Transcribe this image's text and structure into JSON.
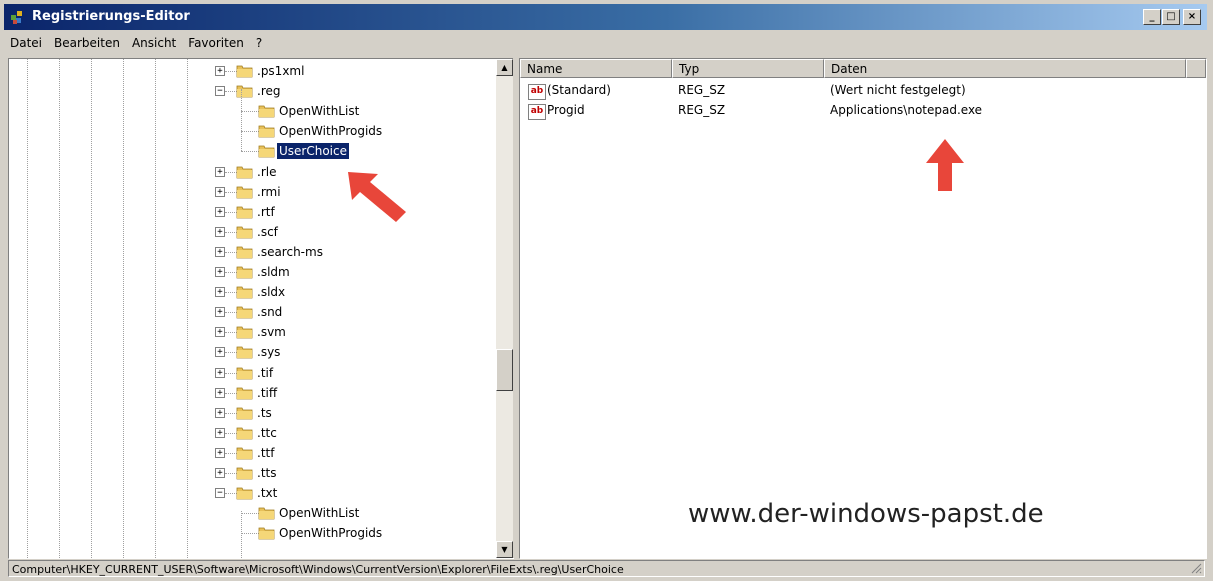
{
  "window": {
    "title": "Registrierungs-Editor"
  },
  "titlebar_buttons": {
    "minimize": "_",
    "maximize": "□",
    "close": "×"
  },
  "menu": [
    "Datei",
    "Bearbeiten",
    "Ansicht",
    "Favoriten",
    "?"
  ],
  "tree": [
    {
      "label": ".ps1xml",
      "expander": "+",
      "depth": 0
    },
    {
      "label": ".reg",
      "expander": "−",
      "depth": 0
    },
    {
      "label": "OpenWithList",
      "expander": "",
      "depth": 1
    },
    {
      "label": "OpenWithProgids",
      "expander": "",
      "depth": 1
    },
    {
      "label": "UserChoice",
      "expander": "",
      "depth": 1,
      "selected": true
    },
    {
      "label": ".rle",
      "expander": "+",
      "depth": 0
    },
    {
      "label": ".rmi",
      "expander": "+",
      "depth": 0
    },
    {
      "label": ".rtf",
      "expander": "+",
      "depth": 0
    },
    {
      "label": ".scf",
      "expander": "+",
      "depth": 0
    },
    {
      "label": ".search-ms",
      "expander": "+",
      "depth": 0
    },
    {
      "label": ".sldm",
      "expander": "+",
      "depth": 0
    },
    {
      "label": ".sldx",
      "expander": "+",
      "depth": 0
    },
    {
      "label": ".snd",
      "expander": "+",
      "depth": 0
    },
    {
      "label": ".svm",
      "expander": "+",
      "depth": 0
    },
    {
      "label": ".sys",
      "expander": "+",
      "depth": 0
    },
    {
      "label": ".tif",
      "expander": "+",
      "depth": 0
    },
    {
      "label": ".tiff",
      "expander": "+",
      "depth": 0
    },
    {
      "label": ".ts",
      "expander": "+",
      "depth": 0
    },
    {
      "label": ".ttc",
      "expander": "+",
      "depth": 0
    },
    {
      "label": ".ttf",
      "expander": "+",
      "depth": 0
    },
    {
      "label": ".tts",
      "expander": "+",
      "depth": 0
    },
    {
      "label": ".txt",
      "expander": "−",
      "depth": 0
    },
    {
      "label": "OpenWithList",
      "expander": "",
      "depth": 1
    },
    {
      "label": "OpenWithProgids",
      "expander": "",
      "depth": 1
    }
  ],
  "values_table": {
    "columns": [
      "Name",
      "Typ",
      "Daten"
    ],
    "rows": [
      {
        "icon": "ab",
        "name": "(Standard)",
        "type": "REG_SZ",
        "data": "(Wert nicht festgelegt)"
      },
      {
        "icon": "ab",
        "name": "Progid",
        "type": "REG_SZ",
        "data": "Applications\\notepad.exe"
      }
    ]
  },
  "watermark": "www.der-windows-papst.de",
  "status": "Computer\\HKEY_CURRENT_USER\\Software\\Microsoft\\Windows\\CurrentVersion\\Explorer\\FileExts\\.reg\\UserChoice",
  "annotation_color": "#e8463a"
}
